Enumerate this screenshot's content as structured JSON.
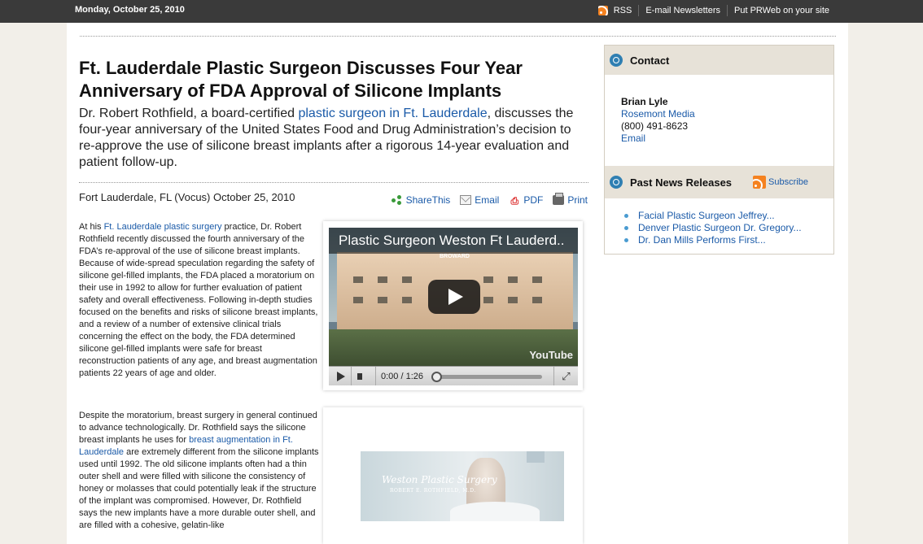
{
  "topbar": {
    "date": "Monday, October 25, 2010",
    "rss_label": "RSS",
    "newsletters_label": "E-mail Newsletters",
    "prweb_label": "Put PRWeb on your site"
  },
  "article": {
    "headline": "Ft. Lauderdale Plastic Surgeon Discusses Four Year Anniversary of FDA Approval of Silicone Implants",
    "summary_pre": "Dr. Robert Rothfield, a board-certified ",
    "summary_link": "plastic surgeon in Ft. Lauderdale",
    "summary_post": ", discusses the four-year anniversary of the United States Food and Drug Administration’s decision to re-approve the use of silicone breast implants after a rigorous 14-year evaluation and patient follow-up.",
    "dateline": "Fort Lauderdale, FL (Vocus) October 25, 2010",
    "tools": {
      "share": "ShareThis",
      "email": "Email",
      "pdf": "PDF",
      "print": "Print"
    },
    "para1_pre": "At his ",
    "para1_link": "Ft. Lauderdale plastic surgery",
    "para1_post": " practice, Dr. Robert Rothfield recently discussed the fourth anniversary of the FDA’s re-approval of the use of silicone breast implants. Because of wide-spread speculation regarding the safety of silicone gel-filled implants, the FDA placed a moratorium on their use in 1992 to allow for further evaluation of patient safety and overall effectiveness. Following in-depth studies focused on the benefits and risks of silicone breast implants, and a review of a number of extensive clinical trials concerning the effect on the body, the FDA determined silicone gel-filled implants were safe for breast reconstruction patients of any age, and breast augmentation patients 22 years of age and older.",
    "para2_pre": "Despite the moratorium, breast surgery in general continued to advance technologically. Dr. Rothfield says the silicone breast implants he uses for ",
    "para2_link": "breast augmentation in Ft. Lauderdale",
    "para2_post": " are extremely different from the silicone implants used until 1992. The old silicone implants often had a thin outer shell and were filled with silicone the consistency of honey or molasses that could potentially leak if the structure of the implant was compromised. However, Dr. Rothfield says the new implants have a more durable outer shell, and are filled with a cohesive, gelatin-like"
  },
  "video": {
    "title": "Plastic Surgeon Weston Ft Lauderd..",
    "time": "0:00 / 1:26",
    "progress": 0,
    "logo": "YouTube",
    "building_sign": "BROWARD"
  },
  "image_banner": {
    "script_text": "Weston Plastic Surgery",
    "sub_text": "ROBERT E. ROTHFIELD, M.D."
  },
  "sidebar": {
    "contact_title": "Contact",
    "contact_name": "Brian Lyle",
    "contact_company": "Rosemont Media",
    "contact_phone": "(800) 491-8623",
    "contact_email": "Email",
    "news_title": "Past News Releases",
    "subscribe": "Subscribe",
    "news_items": [
      "Facial Plastic Surgeon Jeffrey...",
      "Denver Plastic Surgeon Dr. Gregory...",
      "Dr. Dan Mills Performs First..."
    ]
  },
  "colors": {
    "topbar": "#3a3a3a",
    "link": "#1a5aa8",
    "sidebar_header": "#e7e2d8",
    "rss": "#f58220"
  }
}
